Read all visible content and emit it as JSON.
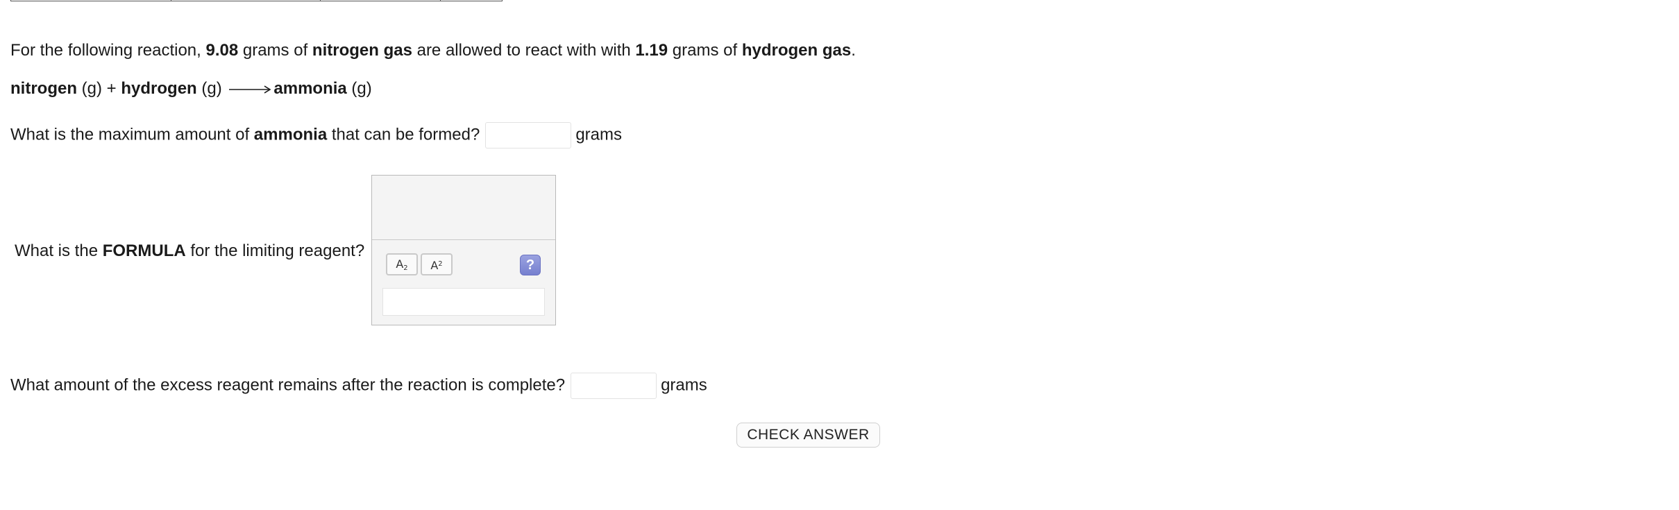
{
  "problem": {
    "intro_prefix": "For the following reaction, ",
    "mass_nitrogen": "9.08",
    "grams_of_1": " grams of ",
    "reactant1": "nitrogen gas",
    "allowed_text": " are allowed to react with with ",
    "mass_hydrogen": "1.19",
    "grams_of_2": " grams of ",
    "reactant2": "hydrogen gas",
    "intro_suffix": "."
  },
  "equation": {
    "reactant1": "nitrogen",
    "reactant1_state": " (g) + ",
    "reactant2": "hydrogen",
    "reactant2_state": " (g) ",
    "product": "ammonia",
    "product_state": " (g)"
  },
  "question1": {
    "prefix": "What is the maximum amount of ",
    "bold": "ammonia",
    "suffix": " that can be formed?",
    "value": "",
    "unit": "grams"
  },
  "question2": {
    "prefix": "What is the ",
    "bold": "FORMULA",
    "suffix": " for the limiting reagent?",
    "subscript_button": "A",
    "subscript_glyph": "2",
    "superscript_button": "A",
    "superscript_glyph": "2",
    "help_label": "?",
    "value": ""
  },
  "question3": {
    "text": "What amount of the excess reagent remains after the reaction is complete?",
    "value": "",
    "unit": "grams"
  },
  "check_button": "CHECK ANSWER"
}
